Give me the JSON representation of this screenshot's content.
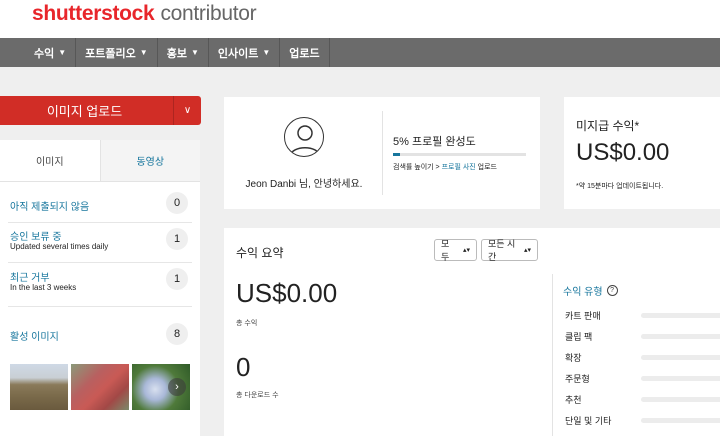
{
  "header": {
    "logo_brand": "shutterstock",
    "logo_product": "contributor"
  },
  "nav": [
    {
      "label": "수익",
      "dropdown": true
    },
    {
      "label": "포트폴리오",
      "dropdown": true
    },
    {
      "label": "홍보",
      "dropdown": true
    },
    {
      "label": "인사이트",
      "dropdown": true
    },
    {
      "label": "업로드",
      "dropdown": false
    }
  ],
  "upload": {
    "label": "이미지 업로드",
    "caret": "∨"
  },
  "media_tabs": {
    "images": "이미지",
    "videos": "동영상",
    "active": "videos"
  },
  "stats": [
    {
      "label": "아직 제출되지 않음",
      "sub": "",
      "count": "0"
    },
    {
      "label": "승인 보류 중",
      "sub": "Updated several times daily",
      "count": "1"
    },
    {
      "label": "최근 거부",
      "sub": "In the last 3 weeks",
      "count": "1"
    },
    {
      "label": "활성 이미지",
      "sub": "",
      "count": "8"
    }
  ],
  "thumbnails": [
    "field-photo",
    "red-machine-photo",
    "hydrangea-photo"
  ],
  "profile": {
    "greeting": "Jeon Danbi 님, 안녕하세요.",
    "completion_title": "5% 프로필 완성도",
    "completion_percent": 5,
    "hint_prefix": "검색률 높이기 > ",
    "hint_link": "프로필 사진",
    "hint_suffix": " 업로드"
  },
  "unpaid": {
    "title": "미지급 수익*",
    "amount": "US$0.00",
    "note": "*약 15분마다 업데이트됩니다."
  },
  "summary": {
    "title": "수익 요약",
    "filter_type": "모두",
    "filter_time": "모든 시간",
    "total_earnings": "US$0.00",
    "total_earnings_label": "총 수익",
    "total_downloads": "0",
    "total_downloads_label": "총 다운로드 수",
    "types_title": "수익 유형",
    "types": [
      "카트 판매",
      "클립 팩",
      "확장",
      "주문형",
      "추천",
      "단일 및 기타"
    ]
  },
  "colors": {
    "brand_red": "#e8262b",
    "link_blue": "#17769d",
    "nav_gray": "#6b6b6b",
    "button_red": "#d12d26"
  }
}
